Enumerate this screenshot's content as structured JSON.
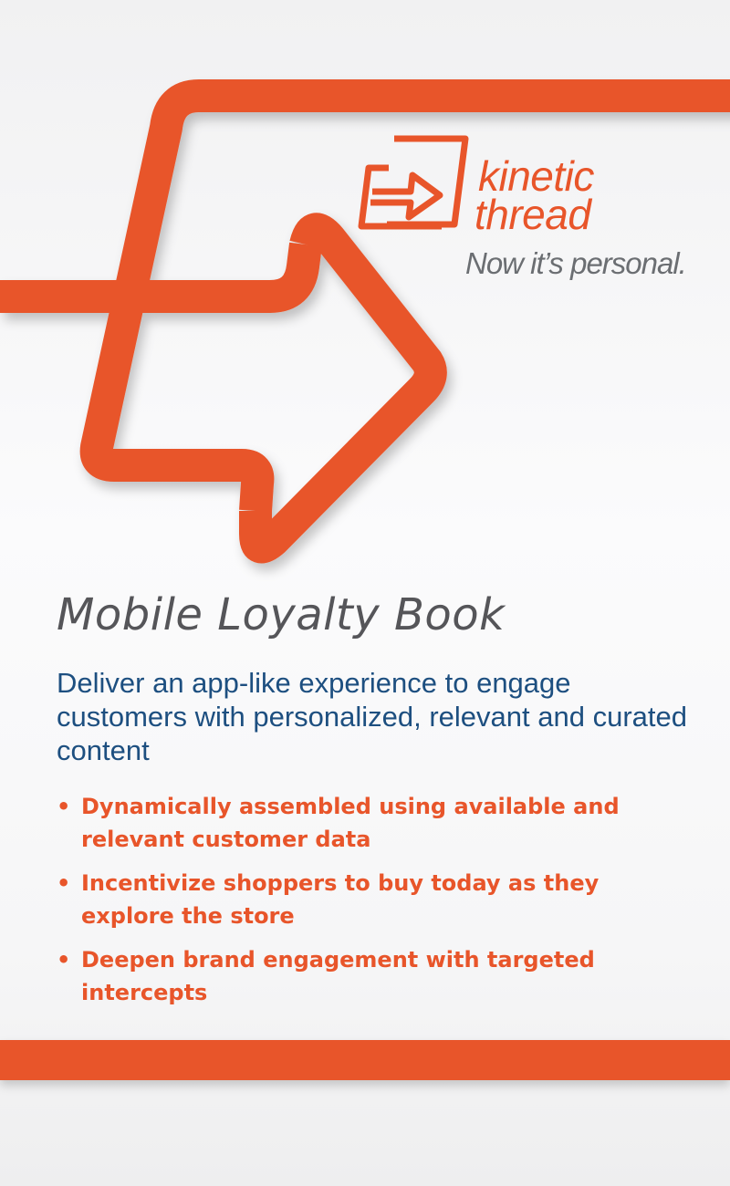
{
  "logo": {
    "icon": "arrow-in-square-icon",
    "word_top": "kinetic",
    "word_bottom": "thread",
    "tagline": "Now it’s personal."
  },
  "product_title": "Mobile Loyalty Book",
  "headline": "Deliver an app-like experience to engage customers with personalized, relevant and curated content",
  "bullets": [
    {
      "marker": "•",
      "text": "Dynamically assembled using available and relevant customer data"
    },
    {
      "marker": "•",
      "text": "Incentivize shoppers to buy today as they explore the store"
    },
    {
      "marker": "•",
      "text": "Deepen brand engagement with targeted intercepts"
    }
  ],
  "colors": {
    "brand_orange": "#e8552a",
    "headline_blue": "#1d4f80",
    "title_gray": "#555559",
    "tagline_gray": "#6b6e72"
  }
}
